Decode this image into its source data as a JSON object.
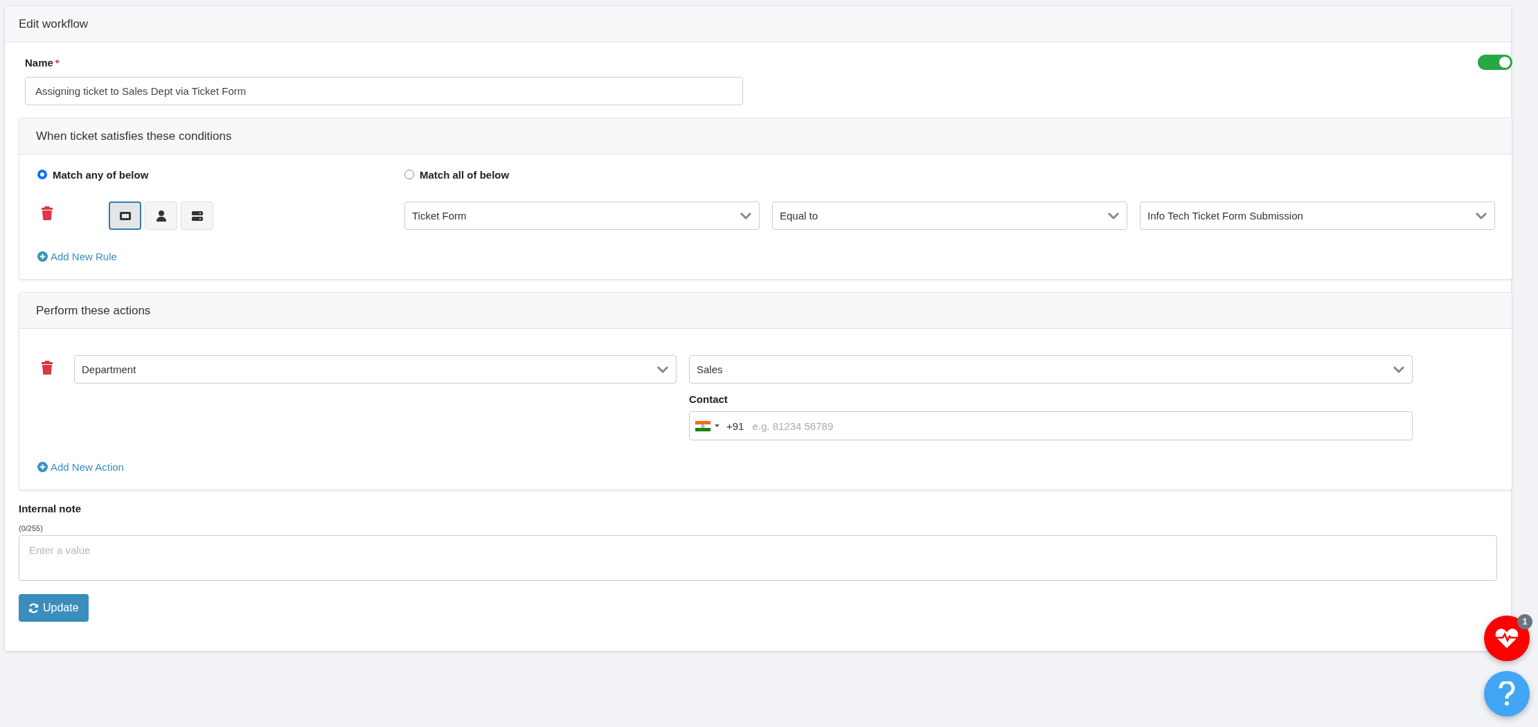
{
  "header": {
    "title": "Edit workflow"
  },
  "name_field": {
    "label": "Name",
    "required_mark": "*",
    "value": "Assigning ticket to Sales Dept via Ticket Form"
  },
  "enabled_toggle": {
    "on": true
  },
  "conditions": {
    "title": "When ticket satisfies these conditions",
    "match_options": [
      {
        "label": "Match any of below",
        "selected": true
      },
      {
        "label": "Match all of below",
        "selected": false
      }
    ],
    "rules": [
      {
        "type_buttons": [
          {
            "kind": "ticket",
            "selected": true
          },
          {
            "kind": "person",
            "selected": false
          },
          {
            "kind": "server",
            "selected": false
          }
        ],
        "field": "Ticket Form",
        "operator": "Equal to",
        "value": "Info Tech Ticket Form Submission"
      }
    ],
    "add_link": "Add New Rule"
  },
  "actions": {
    "title": "Perform these actions",
    "items": [
      {
        "field": "Department",
        "value": "Sales",
        "contact": {
          "label": "Contact",
          "country_code": "+91",
          "placeholder": "e.g. 81234 56789"
        }
      }
    ],
    "add_link": "Add New Action"
  },
  "internal_note": {
    "label": "Internal note",
    "counter": "(0/255)",
    "placeholder": "Enter a value"
  },
  "update_button": "Update",
  "health_badge": "1"
}
